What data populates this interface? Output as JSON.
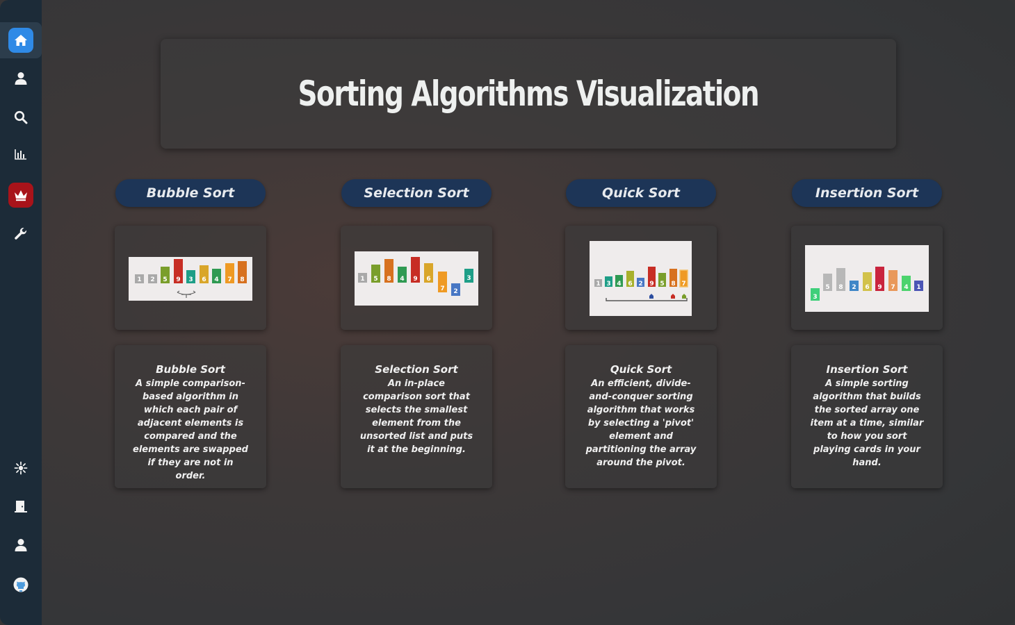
{
  "sidebar": {
    "items": [
      {
        "icon": "home-icon",
        "active": true
      },
      {
        "icon": "user-icon"
      },
      {
        "icon": "search-icon"
      },
      {
        "icon": "bar-chart-icon"
      },
      {
        "icon": "crown-icon"
      },
      {
        "icon": "wrench-icon"
      },
      {
        "icon": "sun-icon"
      },
      {
        "icon": "door-exit-icon"
      },
      {
        "icon": "profile-icon"
      },
      {
        "icon": "github-icon"
      }
    ]
  },
  "header": {
    "title": "Sorting Algorithms Visualization"
  },
  "algorithms": [
    {
      "name": "Bubble Sort",
      "desc_title": "Bubble Sort",
      "description": "A simple comparison-based algorithm in which each pair of adjacent elements is compared and the elements are swapped if they are not in order.",
      "bars": [
        "1",
        "2",
        "5",
        "9",
        "3",
        "6",
        "4",
        "7",
        "8"
      ]
    },
    {
      "name": "Selection Sort",
      "desc_title": "Selection Sort",
      "description": "An in-place comparison sort that selects the smallest element from the unsorted list and puts it at the beginning.",
      "bars": [
        "1",
        "5",
        "8",
        "4",
        "9",
        "6",
        "7",
        "2",
        "3"
      ]
    },
    {
      "name": "Quick Sort",
      "desc_title": "Quick Sort",
      "description": "An efficient, divide-and-conquer sorting algorithm that works by selecting a 'pivot' element and partitioning the array around the pivot.",
      "bars": [
        "1",
        "3",
        "4",
        "6",
        "2",
        "9",
        "5",
        "8",
        "7"
      ]
    },
    {
      "name": "Insertion Sort",
      "desc_title": "Insertion Sort",
      "description": "A simple sorting algorithm that builds the sorted array one item at a time, similar to how you sort playing cards in your hand.",
      "bars": [
        "3",
        "5",
        "8",
        "2",
        "6",
        "9",
        "7",
        "4",
        "1"
      ]
    }
  ],
  "colors": {
    "sidebar_bg": "#1c2b38",
    "pill_bg": "#1d3557",
    "active_tile": "#2f8ae6",
    "crown_tile": "#a8131a"
  }
}
